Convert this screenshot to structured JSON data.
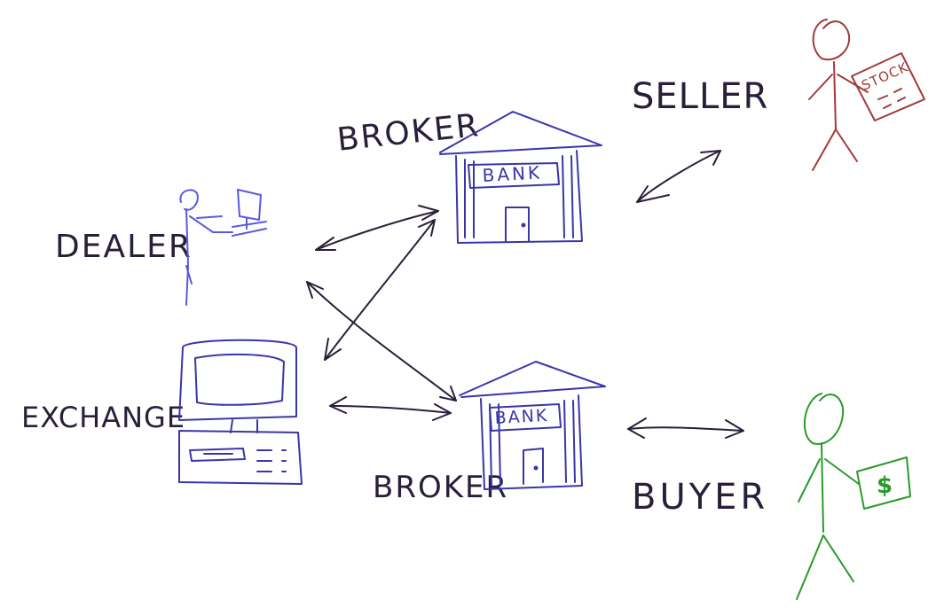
{
  "labels": {
    "seller": "SELLER",
    "broker_top": "BROKER",
    "dealer": "DEALER",
    "exchange": "EXCHANGE",
    "broker_bottom": "BROKER",
    "buyer": "BUYER"
  },
  "building_signs": {
    "top": "BANK",
    "bottom": "BANK"
  },
  "props": {
    "stock_certificate": "STOCK",
    "money": "$"
  },
  "colors": {
    "ink": "#2a1f3a",
    "blue": "#3a36a8",
    "dealer_blue": "#5a5ae0",
    "seller_red": "#a23a3a",
    "buyer_green": "#2a9a2a"
  }
}
